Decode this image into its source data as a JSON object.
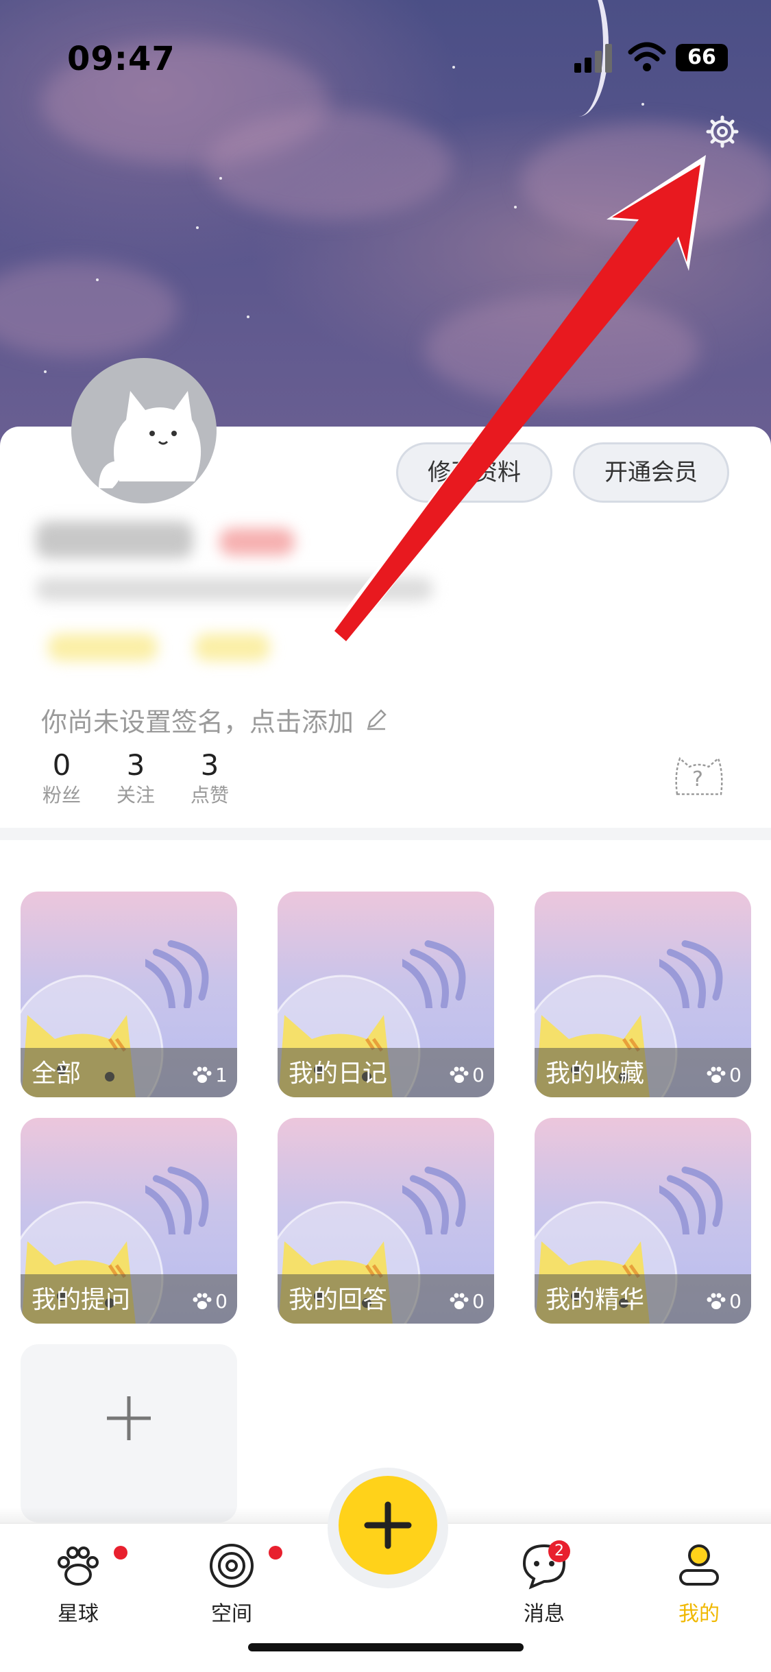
{
  "status": {
    "time": "09:47",
    "battery": "66"
  },
  "profile": {
    "edit_button": "修改资料",
    "vip_button": "开通会员",
    "signature": "你尚未设置签名，点击添加",
    "stats": [
      {
        "value": "0",
        "label": "粉丝"
      },
      {
        "value": "3",
        "label": "关注"
      },
      {
        "value": "3",
        "label": "点赞"
      }
    ]
  },
  "tiles": [
    {
      "title": "全部",
      "count": "1"
    },
    {
      "title": "我的日记",
      "count": "0"
    },
    {
      "title": "我的收藏",
      "count": "0"
    },
    {
      "title": "我的提问",
      "count": "0"
    },
    {
      "title": "我的回答",
      "count": "0"
    },
    {
      "title": "我的精华",
      "count": "0"
    }
  ],
  "nav": {
    "items": [
      {
        "label": "星球"
      },
      {
        "label": "空间"
      },
      {
        "label": "消息",
        "badge": "2"
      },
      {
        "label": "我的"
      }
    ]
  },
  "colors": {
    "accent": "#FFD21A",
    "arrow": "#E8191F",
    "badge": "#E8202E"
  },
  "icons": [
    "gear-icon",
    "pencil-icon",
    "help-cat-icon",
    "paw-icon",
    "planet-icon",
    "message-icon",
    "profile-icon",
    "plus-icon"
  ]
}
